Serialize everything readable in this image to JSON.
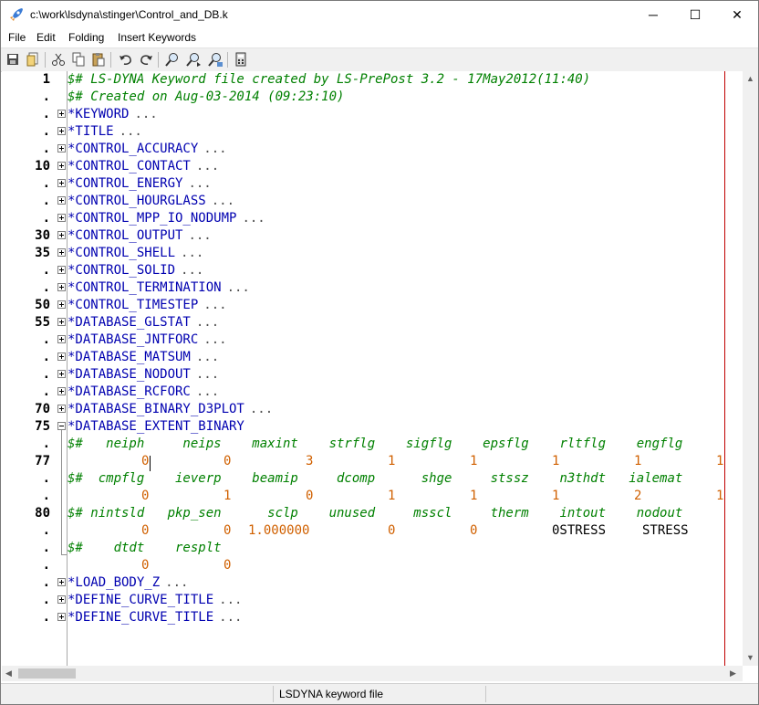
{
  "window": {
    "title": "c:\\work\\lsdyna\\stinger\\Control_and_DB.k",
    "minimize": "─",
    "maximize": "☐",
    "close": "✕"
  },
  "menu": [
    "File",
    "Edit",
    "Folding",
    "Insert Keywords"
  ],
  "toolbar_icons": [
    "save-icon",
    "open-icon",
    "cut-icon",
    "copy-icon",
    "paste-icon",
    "undo-icon",
    "redo-icon",
    "find-icon",
    "find-next-icon",
    "replace-icon",
    "calculator-icon"
  ],
  "gutter": [
    "1",
    ".",
    ".",
    ".",
    ".",
    "10",
    ".",
    ".",
    ".",
    "30",
    "35",
    ".",
    ".",
    "50",
    "55",
    ".",
    ".",
    ".",
    ".",
    "70",
    "75",
    ".",
    "77",
    ".",
    ".",
    "80",
    ".",
    ".",
    ".",
    ".",
    ".",
    "."
  ],
  "header": [
    "$# LS-DYNA Keyword file created by LS-PrePost 3.2 - 17May2012(11:40)",
    "$# Created on Aug-03-2014 (09:23:10)"
  ],
  "folded_keywords": [
    "*KEYWORD",
    "*TITLE",
    "*CONTROL_ACCURACY",
    "*CONTROL_CONTACT",
    "*CONTROL_ENERGY",
    "*CONTROL_HOURGLASS",
    "*CONTROL_MPP_IO_NODUMP",
    "*CONTROL_OUTPUT",
    "*CONTROL_SHELL",
    "*CONTROL_SOLID",
    "*CONTROL_TERMINATION",
    "*CONTROL_TIMESTEP",
    "*DATABASE_GLSTAT",
    "*DATABASE_JNTFORC",
    "*DATABASE_MATSUM",
    "*DATABASE_NODOUT",
    "*DATABASE_RCFORC",
    "*DATABASE_BINARY_D3PLOT"
  ],
  "fold_suffix": "...",
  "open_keyword": "*DATABASE_EXTENT_BINARY",
  "card_comments": [
    "$#   neiph     neips    maxint    strflg    sigflg    epsflg    rltflg    engflg",
    "$#  cmpflg    ieverp    beamip     dcomp      shge     stssz    n3thdt   ialemat",
    "$# nintsld   pkp_sen      sclp    unused     msscl     therm    intout    nodout",
    "$#    dtdt    resplt"
  ],
  "card_values": [
    [
      "0",
      "0",
      "3",
      "1",
      "1",
      "1",
      "1",
      "1"
    ],
    [
      "0",
      "1",
      "0",
      "1",
      "1",
      "1",
      "2",
      "1"
    ],
    [
      "0",
      "0",
      "1.000000",
      "0",
      "0"
    ],
    [
      "0",
      "0"
    ]
  ],
  "card3_text": [
    "0STRESS",
    "STRESS"
  ],
  "trailing_keywords": [
    "*LOAD_BODY_Z",
    "*DEFINE_CURVE_TITLE",
    "*DEFINE_CURVE_TITLE"
  ],
  "status": "LSDYNA keyword file"
}
